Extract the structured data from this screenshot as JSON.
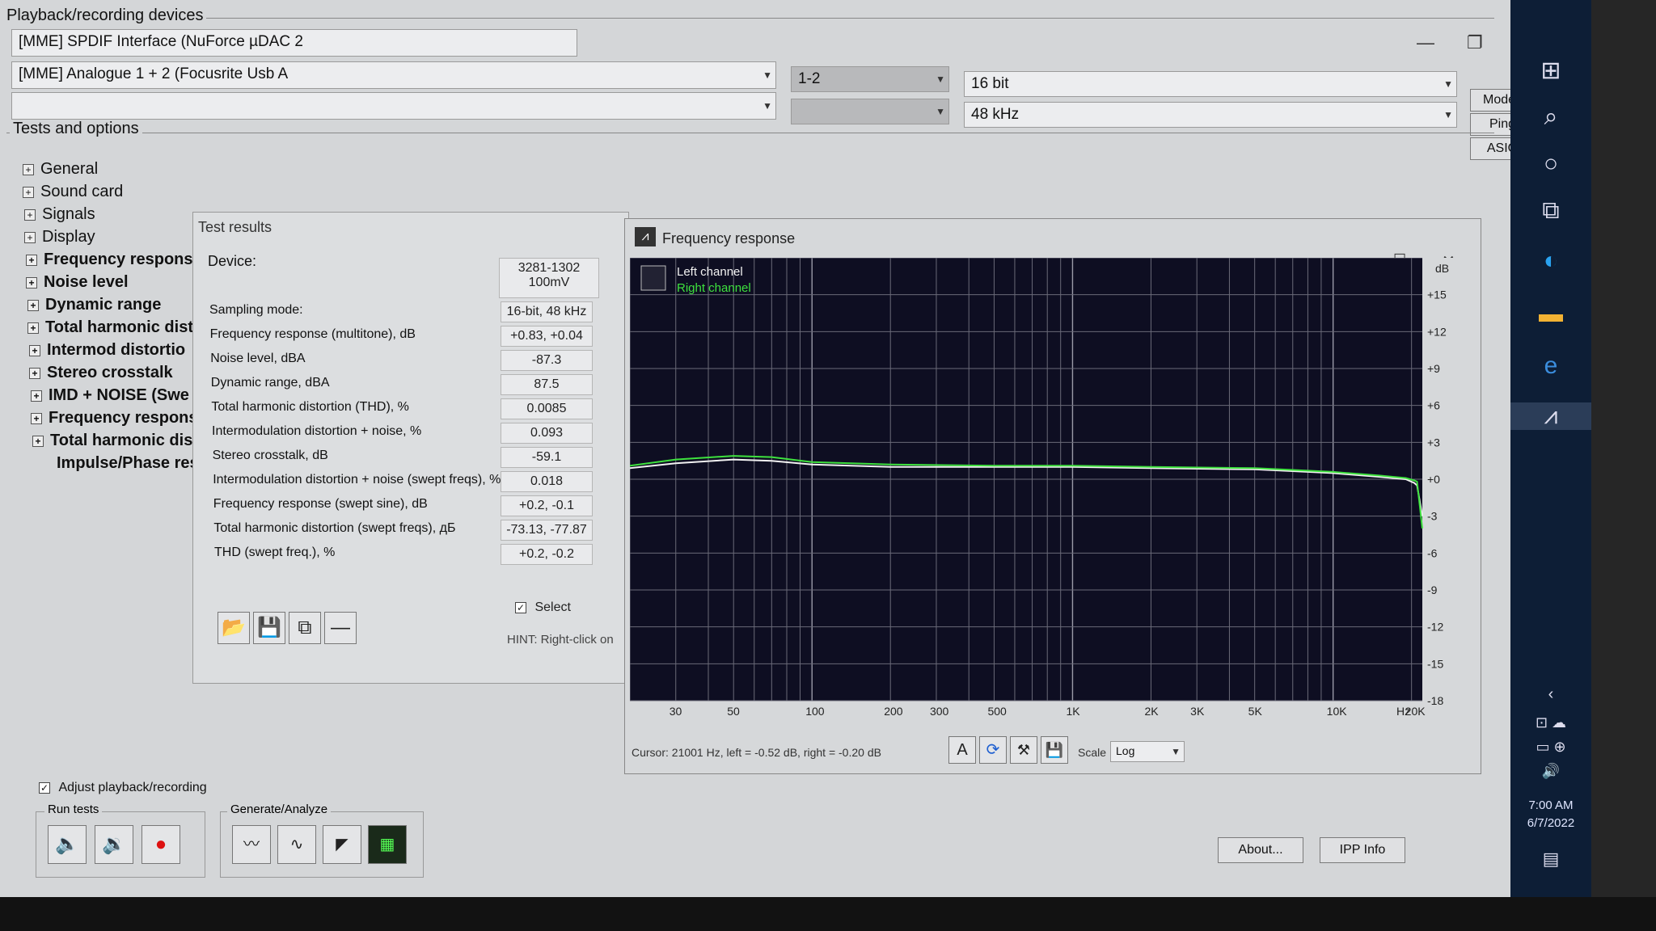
{
  "devices": {
    "section_title": "Playback/recording devices",
    "playback": "[MME] SPDIF Interface (NuForce µDAC 2",
    "recording": "[MME] Analogue 1 + 2 (Focusrite Usb A",
    "channels": "1-2",
    "bits": "16 bit",
    "rate": "48 kHz",
    "buttons": {
      "modes": "Modes",
      "ping": "Ping",
      "asio": "ASIO"
    }
  },
  "tests": {
    "section_title": "Tests and options",
    "items": [
      "General",
      "Sound card",
      "Signals",
      "Display",
      "Frequency respons",
      "Noise level",
      "Dynamic range",
      "Total harmonic dist",
      "Intermod distortio",
      "Stereo crosstalk",
      "IMD + NOISE (Swe",
      "Frequency respons",
      "Total harmonic dis",
      "Impulse/Phase res"
    ]
  },
  "results": {
    "title": "Test results",
    "device_label": "Device:",
    "device_value_line1": "3281-1302",
    "device_value_line2": "100mV",
    "rows": [
      {
        "label": "Sampling mode:",
        "value": "16-bit, 48 kHz"
      },
      {
        "label": "Frequency response (multitone), dB",
        "value": "+0.83, +0.04"
      },
      {
        "label": "Noise level, dBA",
        "value": "-87.3"
      },
      {
        "label": "Dynamic range, dBA",
        "value": "87.5"
      },
      {
        "label": "Total harmonic distortion (THD), %",
        "value": "0.0085"
      },
      {
        "label": "Intermodulation distortion + noise, %",
        "value": "0.093"
      },
      {
        "label": "Stereo crosstalk, dB",
        "value": "-59.1"
      },
      {
        "label": "Intermodulation distortion + noise (swept freqs), %",
        "value": "0.018"
      },
      {
        "label": "Frequency response (swept sine), dB",
        "value": "+0.2, -0.1"
      },
      {
        "label": "Total harmonic distortion (swept freqs), дБ",
        "value": "-73.13, -77.87"
      },
      {
        "label": "THD (swept freq.), %",
        "value": "+0.2, -0.2"
      }
    ],
    "select_label": "Select",
    "hint": "HINT: Right-click on"
  },
  "freq_window": {
    "title": "Frequency response",
    "cursor_text": "Cursor:  21001 Hz,  left = -0.52 dB,  right = -0.20 dB",
    "scale_label": "Scale",
    "scale_value": "Log"
  },
  "bottom": {
    "adjust_label": "Adjust playback/recording",
    "run_tests": "Run tests",
    "generate_analyze": "Generate/Analyze",
    "about": "About...",
    "ipp": "IPP Info"
  },
  "taskbar": {
    "time": "7:00 AM",
    "date": "6/7/2022"
  },
  "chart_data": {
    "type": "line",
    "title": "",
    "xlabel": "Hz",
    "ylabel": "dB",
    "x_scale": "log",
    "xlim": [
      20,
      22000
    ],
    "ylim": [
      -18,
      18
    ],
    "x_ticks": [
      30,
      50,
      100,
      200,
      300,
      500,
      1000,
      2000,
      3000,
      5000,
      10000,
      20000
    ],
    "x_tick_labels": [
      "30",
      "50",
      "100",
      "200",
      "300",
      "500",
      "1K",
      "2K",
      "3K",
      "5K",
      "10K",
      "20K"
    ],
    "y_ticks": [
      15,
      12,
      9,
      6,
      3,
      0,
      -3,
      -6,
      -9,
      -12,
      -15,
      -18
    ],
    "y_tick_labels": [
      "+15",
      "+12",
      "+9",
      "+6",
      "+3",
      "+0",
      "-3",
      "-6",
      "-9",
      "-12",
      "-15",
      "-18"
    ],
    "grid": true,
    "legend": "top-left",
    "series": [
      {
        "name": "Left channel",
        "color": "#f2f2f2",
        "x": [
          20,
          30,
          50,
          70,
          100,
          200,
          500,
          1000,
          2000,
          5000,
          10000,
          15000,
          19000,
          20500,
          21000,
          22000
        ],
        "values": [
          0.9,
          1.3,
          1.6,
          1.5,
          1.2,
          1.0,
          1.0,
          1.0,
          0.9,
          0.8,
          0.5,
          0.2,
          0.0,
          -0.3,
          -0.5,
          -3.0
        ]
      },
      {
        "name": "Right channel",
        "color": "#3ee13e",
        "x": [
          20,
          30,
          50,
          70,
          100,
          200,
          500,
          1000,
          2000,
          5000,
          10000,
          15000,
          19000,
          20500,
          21000,
          22000
        ],
        "values": [
          1.1,
          1.6,
          1.9,
          1.8,
          1.4,
          1.2,
          1.1,
          1.1,
          1.0,
          0.9,
          0.6,
          0.3,
          0.1,
          -0.1,
          -0.2,
          -4.0
        ]
      }
    ]
  }
}
